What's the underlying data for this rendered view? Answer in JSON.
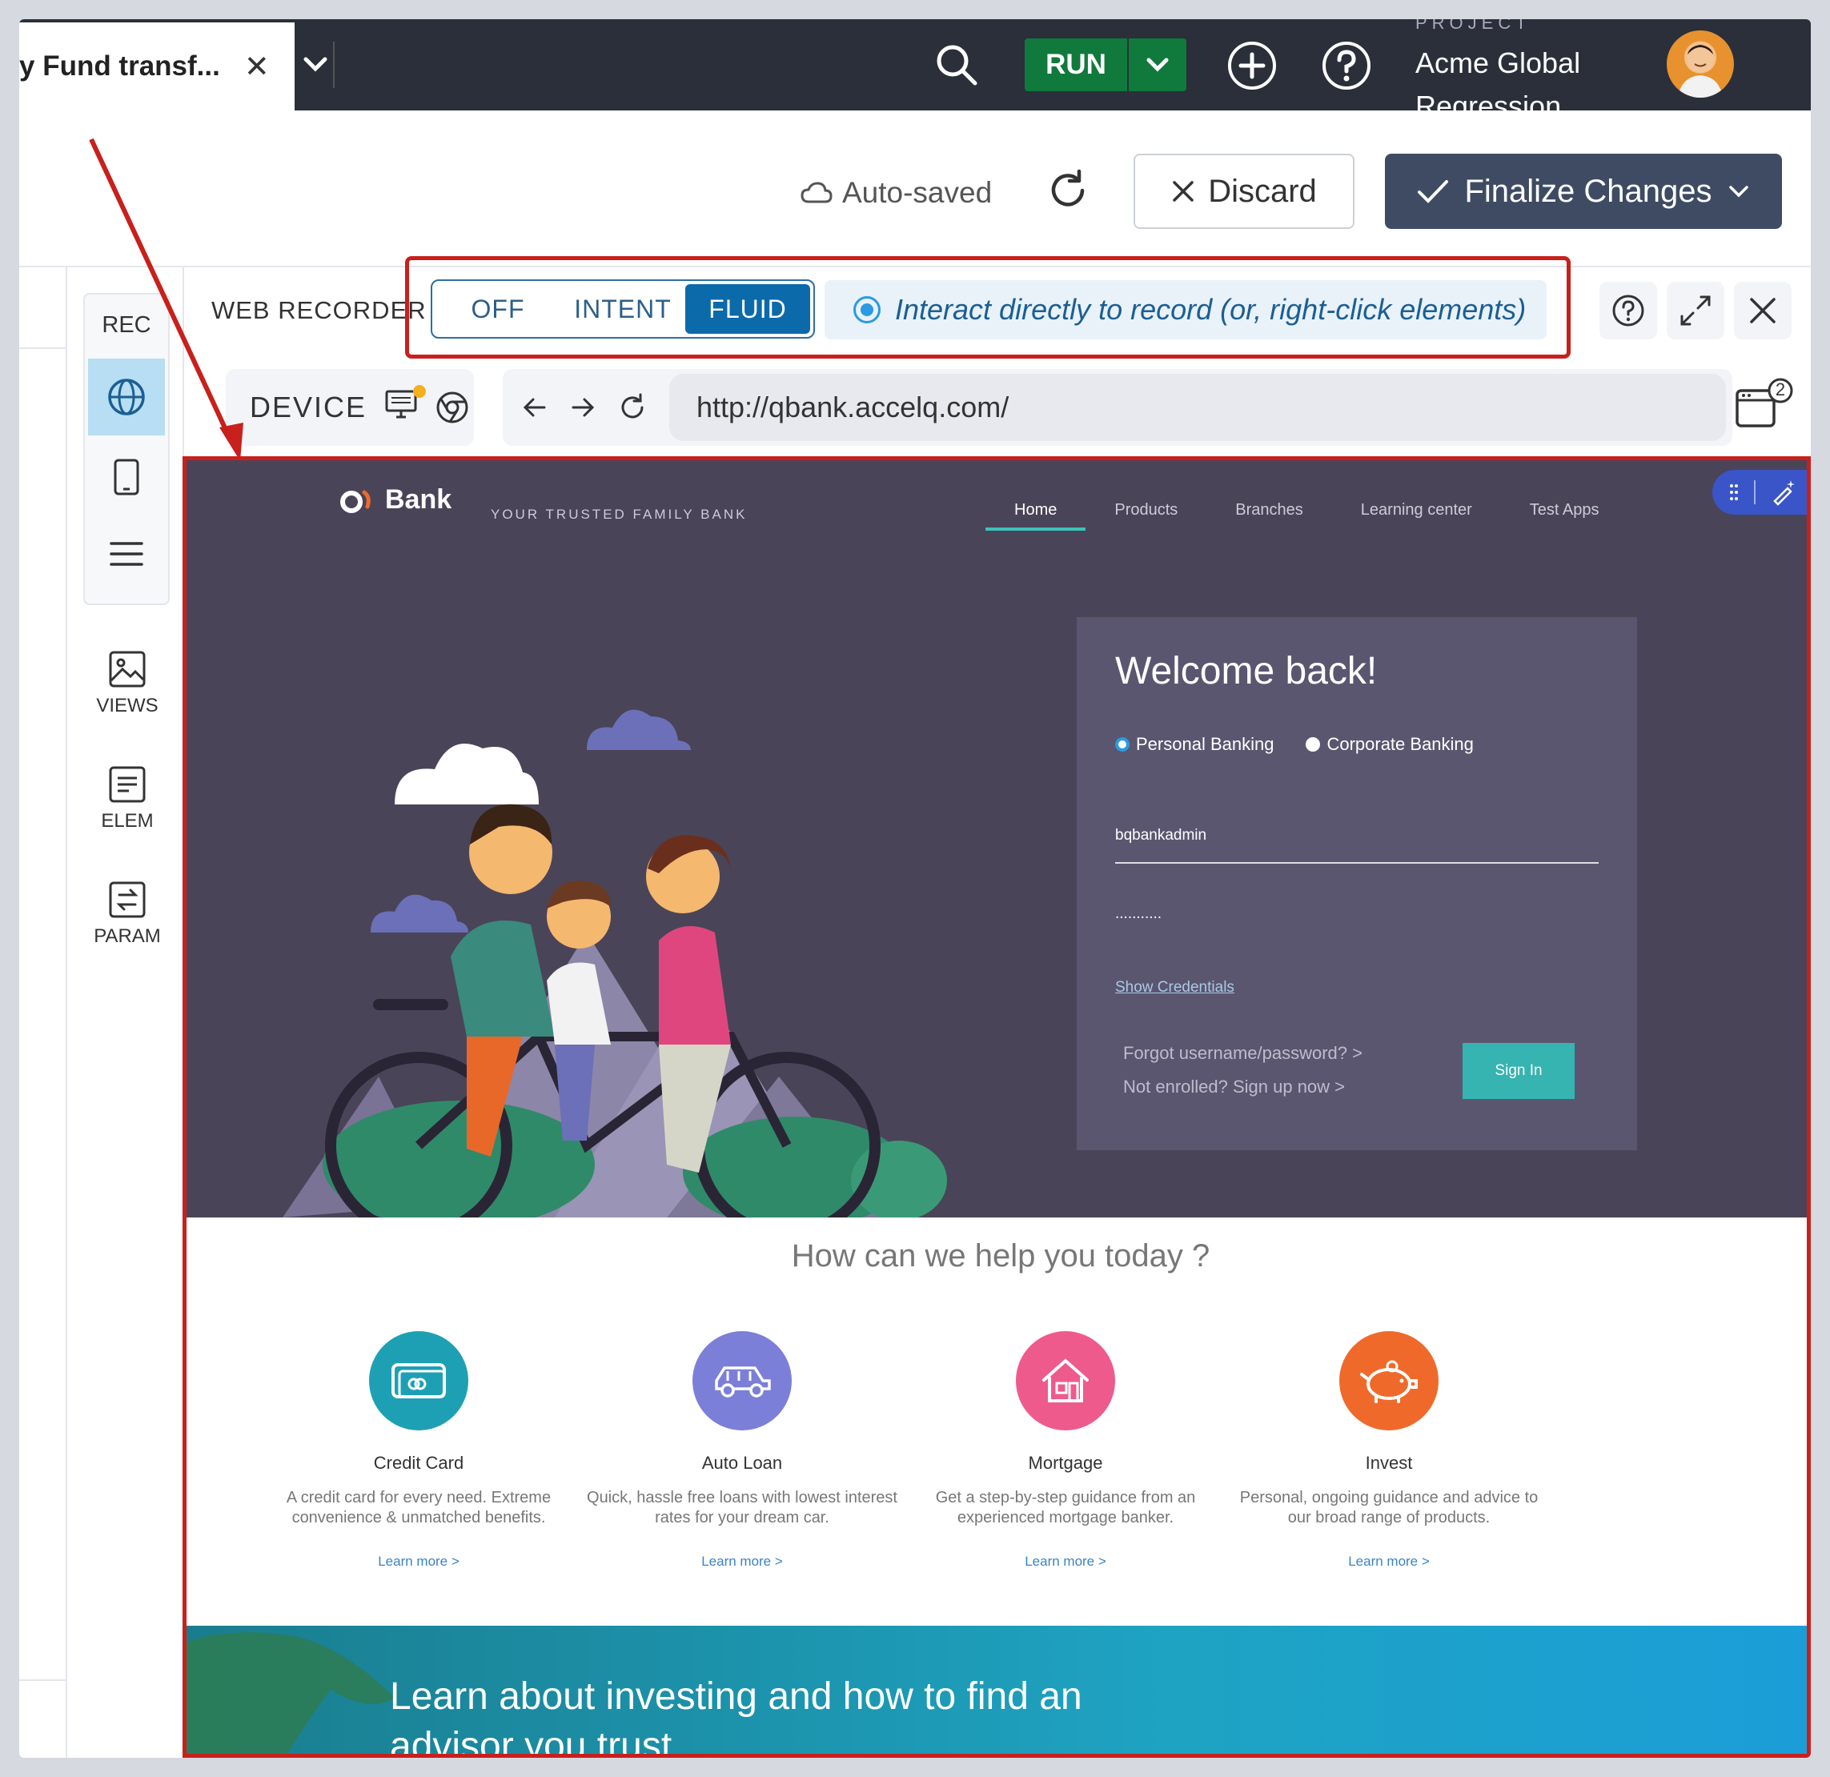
{
  "tab": {
    "title": "y Fund transf...",
    "close_icon": "close-icon"
  },
  "topbar": {
    "run_label": "RUN",
    "project_label": "PROJECT",
    "project_name": "Acme Global Regression"
  },
  "actions": {
    "autosaved": "Auto-saved",
    "discard": "Discard",
    "finalize": "Finalize Changes"
  },
  "sidebar": {
    "rec_label": "REC",
    "tools": [
      {
        "label": "VIEWS"
      },
      {
        "label": "ELEM"
      },
      {
        "label": "PARAM"
      }
    ]
  },
  "recorder": {
    "label": "WEB RECORDER",
    "modes": [
      "OFF",
      "INTENT",
      "FLUID"
    ],
    "active_mode": "FLUID",
    "hint": "Interact directly to record (or, right-click elements)"
  },
  "device": {
    "label": "DEVICE"
  },
  "browser": {
    "url": "http://qbank.accelq.com/",
    "tabs_count": "2"
  },
  "site": {
    "logo_text": "Bank",
    "tagline": "YOUR TRUSTED FAMILY BANK",
    "nav": [
      "Home",
      "Products",
      "Branches",
      "Learning center",
      "Test Apps"
    ],
    "login": {
      "title": "Welcome back!",
      "options": [
        "Personal Banking",
        "Corporate Banking"
      ],
      "username": "bqbankadmin",
      "password_mask": "...........",
      "show_credentials": "Show Credentials",
      "forgot": "Forgot username/password?  >",
      "not_enrolled": "Not enrolled? Sign up now  >",
      "sign_in": "Sign In"
    },
    "help_title": "How can we help you today ?",
    "cards": [
      {
        "title": "Credit Card",
        "desc": "A credit card for every need. Extreme convenience & unmatched benefits.",
        "link": "Learn more  >",
        "color": "#1ea0b4"
      },
      {
        "title": "Auto Loan",
        "desc": "Quick, hassle free loans with lowest interest rates for your dream car.",
        "link": "Learn more  >",
        "color": "#7c7fd8"
      },
      {
        "title": "Mortgage",
        "desc": "Get a step-by-step guidance from an experienced mortgage banker.",
        "link": "Learn more  >",
        "color": "#ef5a8c"
      },
      {
        "title": "Invest",
        "desc": "Personal, ongoing guidance and advice to our broad range of products.",
        "link": "Learn more  >",
        "color": "#ef6a2a"
      }
    ],
    "banner": "Learn about investing and how to find an advisor you trust"
  },
  "colors": {
    "accent_red": "#c8201c",
    "run_green": "#0f7a3c",
    "finalize_bg": "#3e4b63",
    "active_mode": "#0b6aaa"
  }
}
